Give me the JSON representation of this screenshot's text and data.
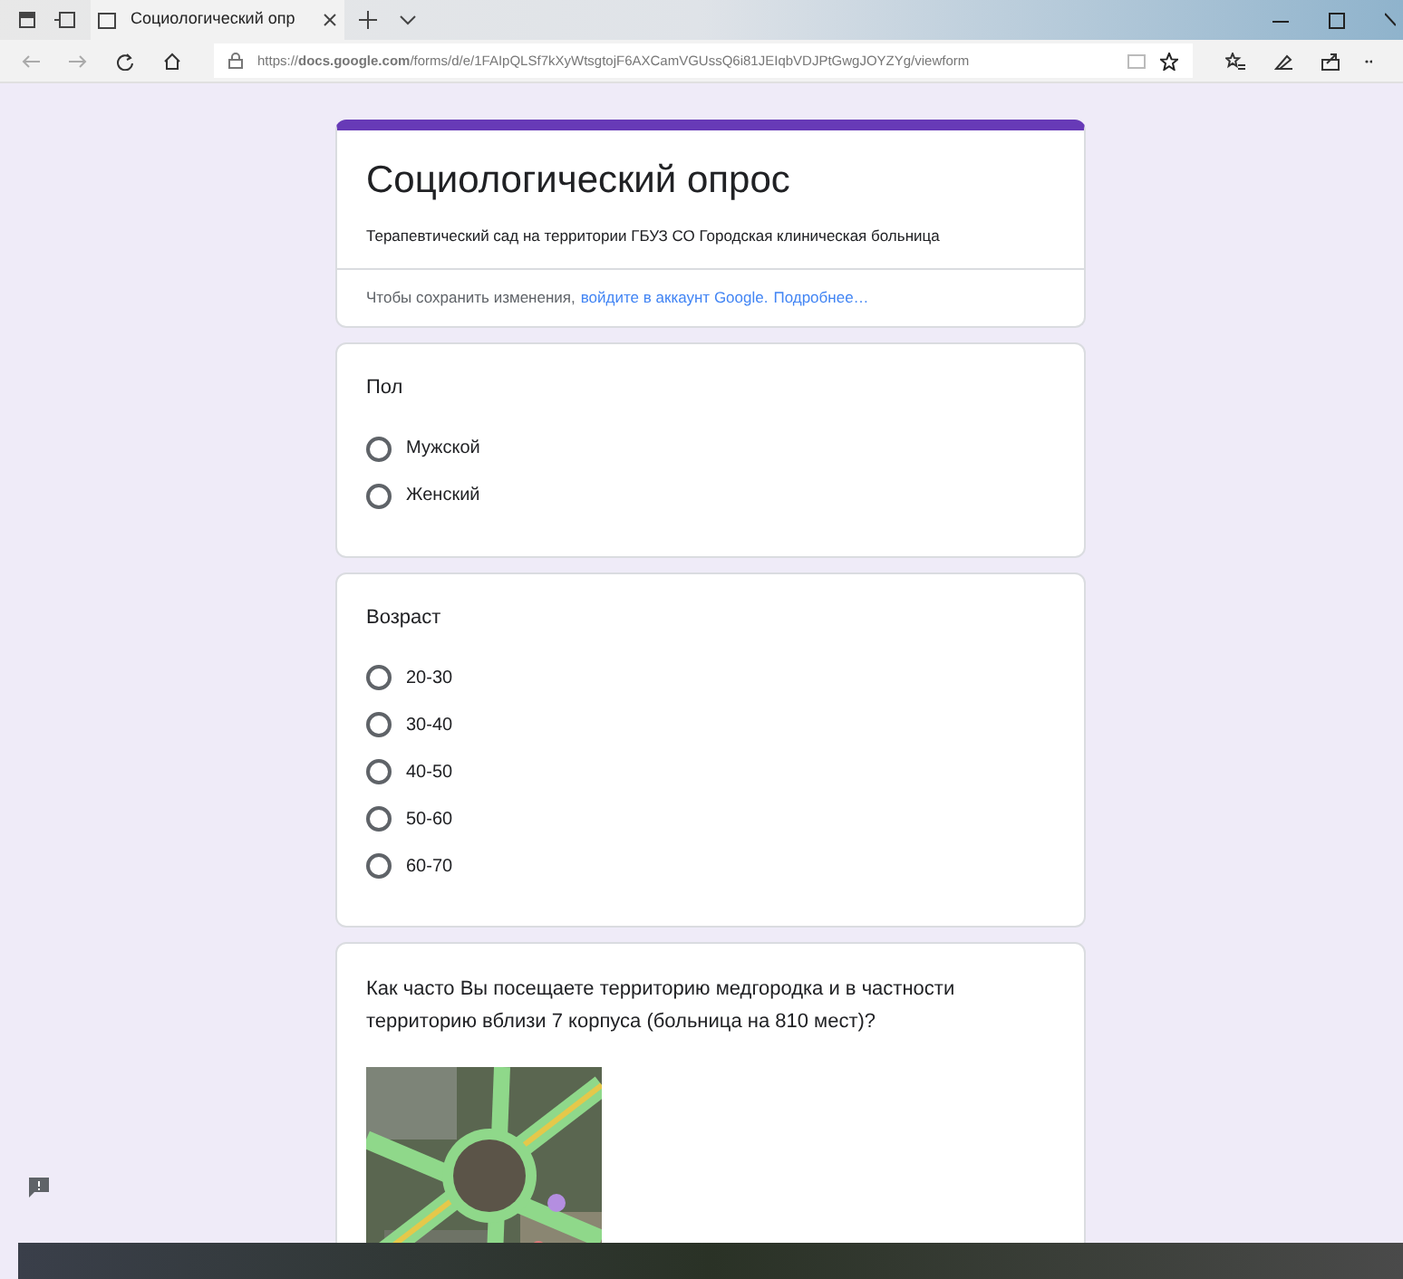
{
  "browser": {
    "tab_title": "Социологический опр",
    "url": "https://**docs.google.com**/forms/d/e/1FAIpQLSf7kXyWtsgtojF6AXCamVGUssQ6i81JEIqbVDJPtGwgJOYZYg/viewform"
  },
  "form": {
    "title": "Социологический опрос",
    "description": "Терапевтический сад на территории ГБУЗ СО Городская клиническая больница",
    "notice": "Чтобы сохранить изменения,",
    "login_link": "войдите в аккаунт Google.",
    "more_link": "Подробнее…"
  },
  "questions": [
    {
      "kind": "radio",
      "title": "Пол",
      "options": [
        {
          "label": "Мужской",
          "selected": false
        },
        {
          "label": "Женский",
          "selected": false
        }
      ]
    },
    {
      "kind": "radio",
      "title": "Возраст",
      "options": [
        {
          "label": "20-30",
          "selected": false
        },
        {
          "label": "30-40",
          "selected": false
        },
        {
          "label": "40-50",
          "selected": false
        },
        {
          "label": "50-60",
          "selected": false
        },
        {
          "label": "60-70",
          "selected": false
        }
      ]
    },
    {
      "title": "Как часто Вы посещаете территорию медгородка и в частности территорию вблизи 7 корпуса (больница на 810 мест)?"
    }
  ]
}
